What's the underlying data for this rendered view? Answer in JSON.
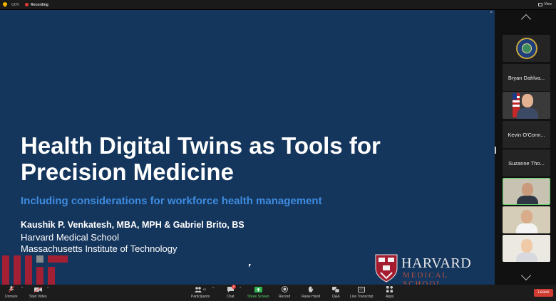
{
  "topbar": {
    "gov_label": "GOV",
    "recording_label": "Recording",
    "view_label": "View"
  },
  "slide": {
    "close": "×",
    "title_line1": "Health Digital Twins as Tools for",
    "title_line2": "Precision Medicine",
    "subtitle": "Including considerations for workforce health management",
    "authors": "Kaushik P. Venkatesh, MBA, MPH & Gabriel Brito, BS",
    "affiliation1": "Harvard Medical School",
    "affiliation2": "Massachusetts Institute of Technology",
    "harvard_word": "HARVARD",
    "harvard_sub": "MEDICAL SCHOOL"
  },
  "participants": [
    {
      "type": "seal",
      "name": ""
    },
    {
      "type": "name",
      "name": "Bryan Dahlva..."
    },
    {
      "type": "video",
      "name": ""
    },
    {
      "type": "name",
      "name": "Kevin O'Conn..."
    },
    {
      "type": "name",
      "name": "Suzanne Tho..."
    },
    {
      "type": "video",
      "name": ""
    },
    {
      "type": "video",
      "name": ""
    },
    {
      "type": "video",
      "name": ""
    }
  ],
  "toolbar": {
    "unmute": "Unmute",
    "start_video": "Start Video",
    "participants": "Participants",
    "participants_count": "61",
    "chat": "Chat",
    "chat_badge": "8",
    "share_screen": "Share Screen",
    "record": "Record",
    "raise_hand": "Raise Hand",
    "qa": "Q&A",
    "live_transcript": "Live Transcript",
    "apps": "Apps",
    "leave": "Leave",
    "cc_icon_text": "CC"
  },
  "colors": {
    "slide_bg": "#14355c",
    "subtitle": "#3e8ce0",
    "mit_red": "#a31f34",
    "harvard_crimson": "#a51c30",
    "leave_red": "#d13b31",
    "share_green": "#2eb34f",
    "active_tile": "#5bd36a"
  }
}
